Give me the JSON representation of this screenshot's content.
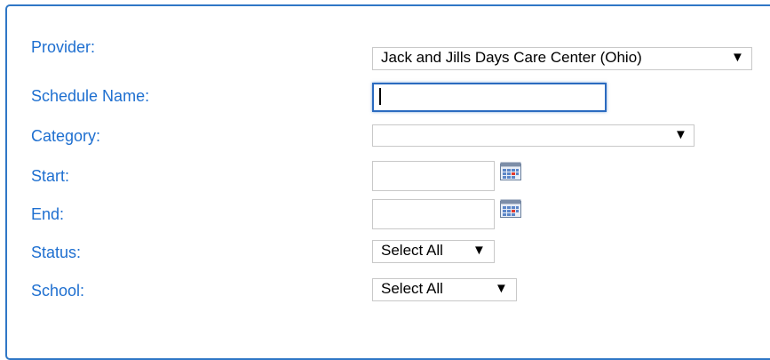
{
  "form": {
    "provider": {
      "label": "Provider:",
      "value": "Jack and Jills Days Care Center (Ohio)"
    },
    "schedule_name": {
      "label": "Schedule Name:",
      "value": ""
    },
    "category": {
      "label": "Category:",
      "value": ""
    },
    "start": {
      "label": "Start:",
      "value": "",
      "icon": "calendar-icon"
    },
    "end": {
      "label": "End:",
      "value": "",
      "icon": "calendar-icon"
    },
    "status": {
      "label": "Status:",
      "value": "Select All"
    },
    "school": {
      "label": "School:",
      "value": "Select All"
    },
    "dropdown_arrow": "▼"
  },
  "colors": {
    "label": "#1e6fd0",
    "panel_border": "#2f77c6",
    "focus_border": "#2b6bc0"
  }
}
